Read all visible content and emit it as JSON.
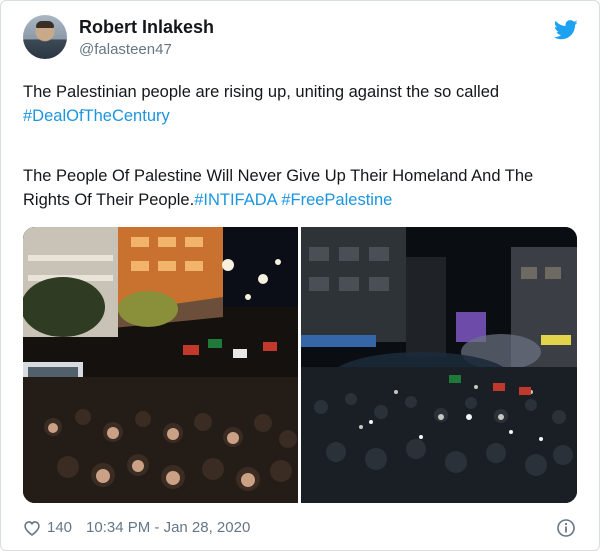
{
  "author": {
    "name": "Robert Inlakesh",
    "handle": "@falasteen47"
  },
  "tweet": {
    "paragraph1": {
      "text": "The Palestinian people are rising up, uniting against the so called ",
      "hashtag": "#DealOfTheCentury"
    },
    "paragraph2": {
      "text": "The People Of Palestine Will Never Give Up Their Homeland And The Rights Of Their People.",
      "hashtag1": "#INTIFADA",
      "hashtag2": "#FreePalestine"
    }
  },
  "footer": {
    "likes": "140",
    "timestamp": "10:34 PM - Jan 28, 2020"
  },
  "icons": {
    "bird": "twitter-bird-icon",
    "heart": "heart-icon",
    "info": "info-icon"
  },
  "colors": {
    "link": "#1b95e0",
    "muted": "#657786",
    "brand": "#1da1f2"
  }
}
